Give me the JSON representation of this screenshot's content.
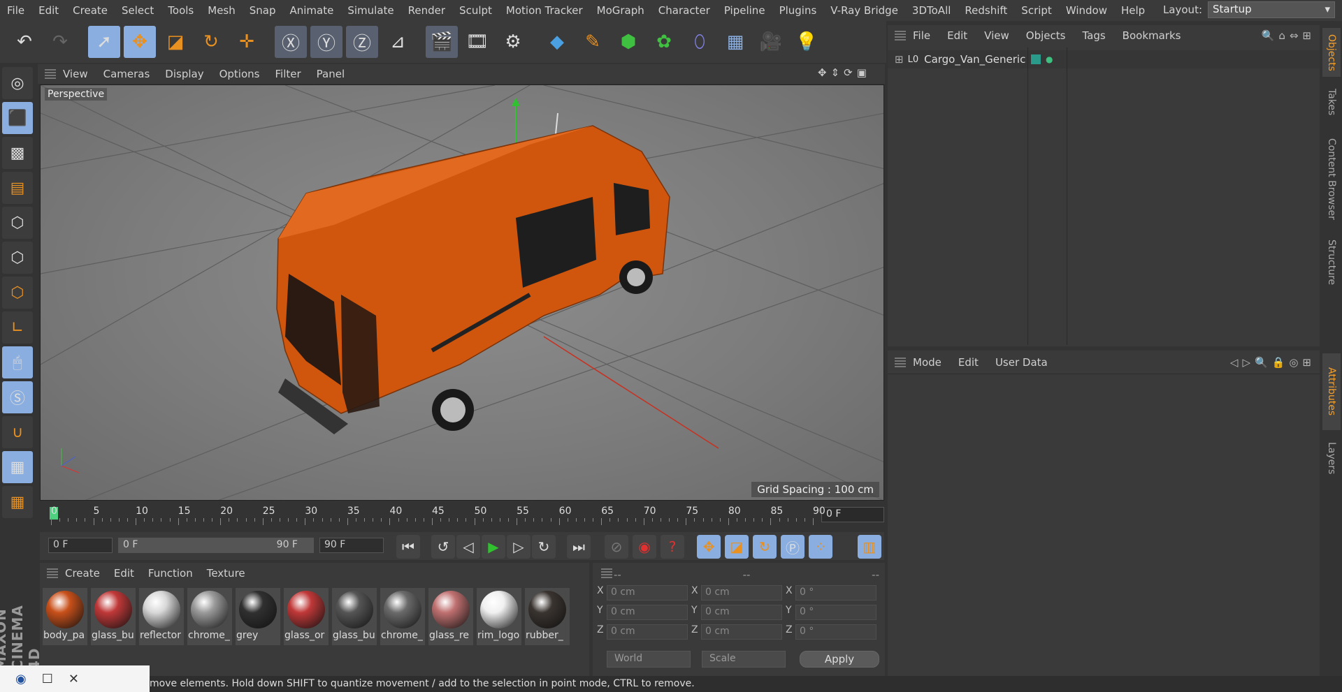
{
  "menu": [
    "File",
    "Edit",
    "Create",
    "Select",
    "Tools",
    "Mesh",
    "Snap",
    "Animate",
    "Simulate",
    "Render",
    "Sculpt",
    "Motion Tracker",
    "MoGraph",
    "Character",
    "Pipeline",
    "Plugins",
    "V-Ray Bridge",
    "3DToAll",
    "Redshift",
    "Script",
    "Window",
    "Help"
  ],
  "layout": {
    "label": "Layout:",
    "value": "Startup"
  },
  "viewport": {
    "menu": [
      "View",
      "Cameras",
      "Display",
      "Options",
      "Filter",
      "Panel"
    ],
    "camera_label": "Perspective",
    "grid_spacing": "Grid Spacing : 100 cm"
  },
  "timeline": {
    "ticks": [
      "0",
      "5",
      "10",
      "15",
      "20",
      "25",
      "30",
      "35",
      "40",
      "45",
      "50",
      "55",
      "60",
      "65",
      "70",
      "75",
      "80",
      "85",
      "90"
    ],
    "current_frame": "0 F",
    "start_field": "0 F",
    "range_start": "0 F",
    "range_end": "90 F",
    "end_field": "90 F"
  },
  "material_manager": {
    "menu": [
      "Create",
      "Edit",
      "Function",
      "Texture"
    ],
    "materials": [
      {
        "name": "body_pa",
        "color": "#c8501a"
      },
      {
        "name": "glass_bu",
        "color": "#c03838"
      },
      {
        "name": "reflector",
        "color": "#d8d8d8"
      },
      {
        "name": "chrome_",
        "color": "#9a9a9a"
      },
      {
        "name": "grey",
        "color": "#303030"
      },
      {
        "name": "glass_or",
        "color": "#c03838"
      },
      {
        "name": "glass_bu",
        "color": "#555555"
      },
      {
        "name": "chrome_",
        "color": "#6a6a6a"
      },
      {
        "name": "glass_re",
        "color": "#c07070"
      },
      {
        "name": "rim_logo",
        "color": "#f0f0f0"
      },
      {
        "name": "rubber_",
        "color": "#3a3430"
      }
    ]
  },
  "coordinates": {
    "headers": [
      "--",
      "--",
      "--"
    ],
    "rows": [
      {
        "a": "X",
        "av": "0 cm",
        "b": "X",
        "bv": "0 cm",
        "c": "X",
        "cv": "0 °"
      },
      {
        "a": "Y",
        "av": "0 cm",
        "b": "Y",
        "bv": "0 cm",
        "c": "Y",
        "cv": "0 °"
      },
      {
        "a": "Z",
        "av": "0 cm",
        "b": "Z",
        "bv": "0 cm",
        "c": "Z",
        "cv": "0 °"
      }
    ],
    "world": "World",
    "scale": "Scale",
    "apply": "Apply"
  },
  "object_manager": {
    "menu": [
      "File",
      "Edit",
      "View",
      "Objects",
      "Tags",
      "Bookmarks"
    ],
    "objects": [
      {
        "name": "Cargo_Van_Generic"
      }
    ]
  },
  "attribute_manager": {
    "menu": [
      "Mode",
      "Edit",
      "User Data"
    ]
  },
  "right_tabs": [
    "Objects",
    "Takes",
    "Content Browser",
    "Structure",
    "Attributes",
    "Layers"
  ],
  "status": "move elements. Hold down SHIFT to quantize movement / add to the selection in point mode, CTRL to remove.",
  "logo_text": "MAXON CINEMA 4D",
  "accent": "#8aaee0",
  "van_color": "#d0560e"
}
